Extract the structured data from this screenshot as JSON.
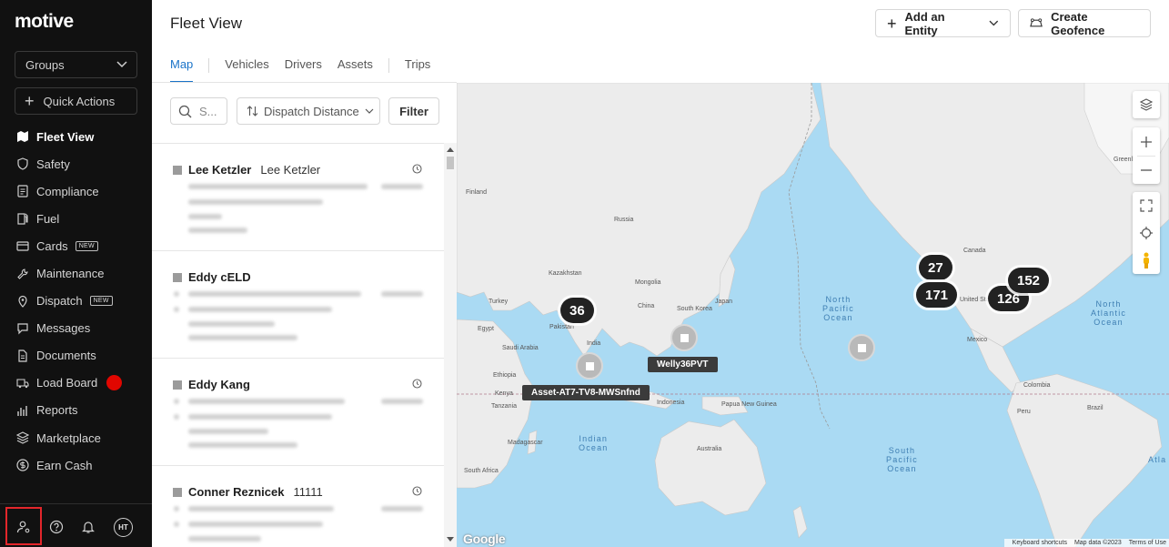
{
  "sidebar": {
    "logo": "motive",
    "groups_label": "Groups",
    "quick_actions_label": "Quick Actions",
    "items": [
      {
        "label": "Fleet View",
        "icon": "map-icon"
      },
      {
        "label": "Safety",
        "icon": "shield-icon"
      },
      {
        "label": "Compliance",
        "icon": "document-list-icon"
      },
      {
        "label": "Fuel",
        "icon": "fuel-pump-icon"
      },
      {
        "label": "Cards",
        "icon": "card-icon",
        "badge": "NEW"
      },
      {
        "label": "Maintenance",
        "icon": "wrench-icon"
      },
      {
        "label": "Dispatch",
        "icon": "location-pin-icon",
        "badge": "NEW"
      },
      {
        "label": "Messages",
        "icon": "chat-icon"
      },
      {
        "label": "Documents",
        "icon": "file-icon"
      },
      {
        "label": "Load Board",
        "icon": "truck-icon"
      },
      {
        "label": "Reports",
        "icon": "bar-chart-icon"
      },
      {
        "label": "Marketplace",
        "icon": "layers-icon"
      },
      {
        "label": "Earn Cash",
        "icon": "dollar-icon"
      }
    ],
    "avatar_initials": "HT"
  },
  "header": {
    "title": "Fleet View",
    "add_entity_label": "Add an Entity",
    "create_geofence_label": "Create Geofence",
    "tabs": [
      "Map",
      "Vehicles",
      "Drivers",
      "Assets",
      "Trips"
    ]
  },
  "filters": {
    "search_placeholder": "S...",
    "dispatch_label": "Dispatch Distance",
    "filter_label": "Filter"
  },
  "list": [
    {
      "name": "Lee Ketzler",
      "sub": "Lee Ketzler"
    },
    {
      "name": "Eddy cELD",
      "sub": ""
    },
    {
      "name": "Eddy Kang",
      "sub": ""
    },
    {
      "name": "Conner Reznicek",
      "sub": "11111"
    }
  ],
  "map": {
    "clusters": [
      "36",
      "27",
      "171",
      "152",
      "126"
    ],
    "asset_labels": [
      "Welly36PVT",
      "Asset-AT7-TV8-MWSnfnd"
    ],
    "oceans": {
      "north_pacific": "North\nPacific\nOcean",
      "north_atlantic": "North\nAtlantic\nOcean",
      "indian": "Indian\nOcean",
      "south_pacific": "South\nPacific\nOcean",
      "south_atlantic": "Atla"
    },
    "places": [
      "Greenland",
      "Finland",
      "Russia",
      "Kazakhstan",
      "Turkey",
      "Egypt",
      "Saudi Arabia",
      "Pakistan",
      "India",
      "China",
      "Mongolia",
      "South Korea",
      "Japan",
      "Ethiopia",
      "Kenya",
      "Tanzania",
      "Madagascar",
      "South Africa",
      "Indonesia",
      "Papua New Guinea",
      "Australia",
      "Canada",
      "United States",
      "Mexico",
      "Colombia",
      "Brazil",
      "Peru"
    ],
    "attribution": {
      "shortcuts": "Keyboard shortcuts",
      "data": "Map data ©2023",
      "terms": "Terms of Use"
    },
    "google": "Google"
  }
}
